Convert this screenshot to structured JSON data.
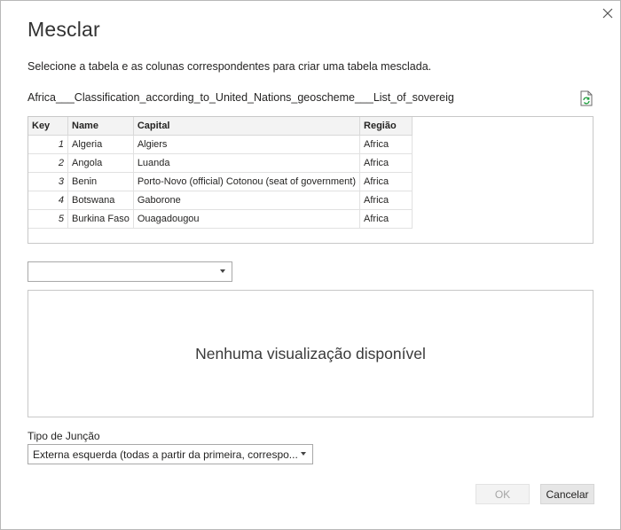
{
  "dialog": {
    "title": "Mesclar",
    "instruction": "Selecione a tabela e as colunas correspondentes para criar uma tabela mesclada.",
    "table_name": "Africa___Classification_according_to_United_Nations_geoscheme___List_of_sovereig",
    "icons": {
      "close": "close-icon",
      "refresh": "refresh-icon"
    }
  },
  "preview_table": {
    "columns": [
      "Key",
      "Name",
      "Capital",
      "Região"
    ],
    "rows": [
      [
        "1",
        "Algeria",
        "Algiers",
        "Africa"
      ],
      [
        "2",
        "Angola",
        "Luanda",
        "Africa"
      ],
      [
        "3",
        "Benin",
        "Porto-Novo (official) Cotonou (seat of government)",
        "Africa"
      ],
      [
        "4",
        "Botswana",
        "Gaborone",
        "Africa"
      ],
      [
        "5",
        "Burkina Faso",
        "Ouagadougou",
        "Africa"
      ]
    ]
  },
  "second_table": {
    "selected": "",
    "empty_message": "Nenhuma visualização disponível"
  },
  "join": {
    "label": "Tipo de Junção",
    "value": "Externa esquerda (todas a partir da primeira, correspo..."
  },
  "buttons": {
    "ok": "OK",
    "cancel": "Cancelar"
  },
  "colors": {
    "ok_disabled_text": "#a6a6a6",
    "cancel_bg": "#e6e6e6",
    "header_bg": "#f3f3f3"
  }
}
